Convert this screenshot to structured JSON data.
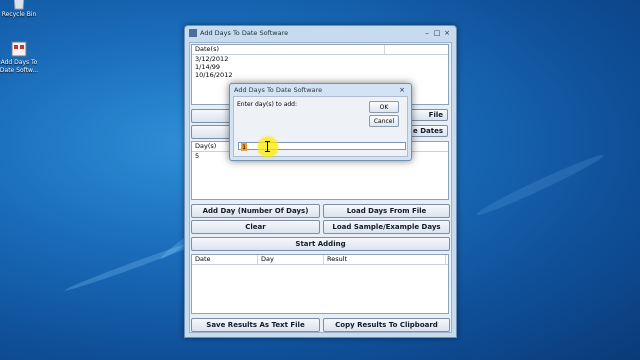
{
  "desktop": {
    "icons": [
      {
        "label": "Recycle Bin",
        "icon": "recycle-bin-icon"
      },
      {
        "label": "Add Days To Date Softw...",
        "icon": "app-shortcut-icon"
      }
    ]
  },
  "window": {
    "title": "Add Days To Date Software",
    "dates_list": {
      "header": "Date(s)",
      "rows": [
        "3/12/2012",
        "1/14/99",
        "10/16/2012"
      ]
    },
    "hidden_buttons": {
      "load_file_fragment": "File",
      "sample_dates_fragment": "e Dates"
    },
    "days_list": {
      "header": "Day(s)",
      "rows": [
        "5"
      ]
    },
    "buttons": {
      "add_day": "Add Day (Number Of Days)",
      "load_days": "Load Days From File",
      "clear": "Clear",
      "load_sample": "Load Sample/Example Days",
      "start": "Start Adding",
      "save_results": "Save Results As Text File",
      "copy_results": "Copy Results To Clipboard"
    },
    "results": {
      "columns": [
        "Date",
        "Day",
        "Result"
      ]
    }
  },
  "dialog": {
    "title": "Add Days To Date Software",
    "prompt": "Enter day(s) to add:",
    "ok": "OK",
    "cancel": "Cancel",
    "input_value": "1"
  }
}
